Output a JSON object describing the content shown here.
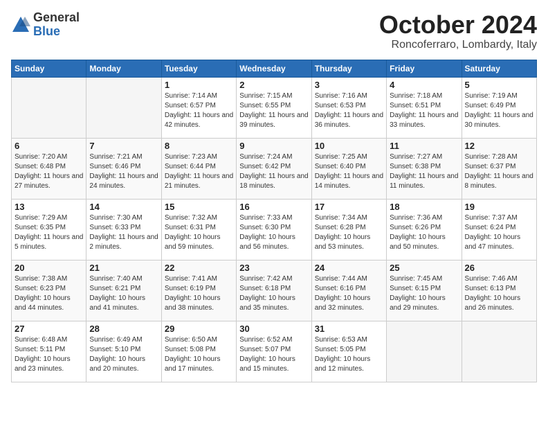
{
  "header": {
    "logo_general": "General",
    "logo_blue": "Blue",
    "month_title": "October 2024",
    "location": "Roncoferraro, Lombardy, Italy"
  },
  "calendar": {
    "days_of_week": [
      "Sunday",
      "Monday",
      "Tuesday",
      "Wednesday",
      "Thursday",
      "Friday",
      "Saturday"
    ],
    "weeks": [
      [
        {
          "day": "",
          "info": ""
        },
        {
          "day": "",
          "info": ""
        },
        {
          "day": "1",
          "info": "Sunrise: 7:14 AM\nSunset: 6:57 PM\nDaylight: 11 hours and 42 minutes."
        },
        {
          "day": "2",
          "info": "Sunrise: 7:15 AM\nSunset: 6:55 PM\nDaylight: 11 hours and 39 minutes."
        },
        {
          "day": "3",
          "info": "Sunrise: 7:16 AM\nSunset: 6:53 PM\nDaylight: 11 hours and 36 minutes."
        },
        {
          "day": "4",
          "info": "Sunrise: 7:18 AM\nSunset: 6:51 PM\nDaylight: 11 hours and 33 minutes."
        },
        {
          "day": "5",
          "info": "Sunrise: 7:19 AM\nSunset: 6:49 PM\nDaylight: 11 hours and 30 minutes."
        }
      ],
      [
        {
          "day": "6",
          "info": "Sunrise: 7:20 AM\nSunset: 6:48 PM\nDaylight: 11 hours and 27 minutes."
        },
        {
          "day": "7",
          "info": "Sunrise: 7:21 AM\nSunset: 6:46 PM\nDaylight: 11 hours and 24 minutes."
        },
        {
          "day": "8",
          "info": "Sunrise: 7:23 AM\nSunset: 6:44 PM\nDaylight: 11 hours and 21 minutes."
        },
        {
          "day": "9",
          "info": "Sunrise: 7:24 AM\nSunset: 6:42 PM\nDaylight: 11 hours and 18 minutes."
        },
        {
          "day": "10",
          "info": "Sunrise: 7:25 AM\nSunset: 6:40 PM\nDaylight: 11 hours and 14 minutes."
        },
        {
          "day": "11",
          "info": "Sunrise: 7:27 AM\nSunset: 6:38 PM\nDaylight: 11 hours and 11 minutes."
        },
        {
          "day": "12",
          "info": "Sunrise: 7:28 AM\nSunset: 6:37 PM\nDaylight: 11 hours and 8 minutes."
        }
      ],
      [
        {
          "day": "13",
          "info": "Sunrise: 7:29 AM\nSunset: 6:35 PM\nDaylight: 11 hours and 5 minutes."
        },
        {
          "day": "14",
          "info": "Sunrise: 7:30 AM\nSunset: 6:33 PM\nDaylight: 11 hours and 2 minutes."
        },
        {
          "day": "15",
          "info": "Sunrise: 7:32 AM\nSunset: 6:31 PM\nDaylight: 10 hours and 59 minutes."
        },
        {
          "day": "16",
          "info": "Sunrise: 7:33 AM\nSunset: 6:30 PM\nDaylight: 10 hours and 56 minutes."
        },
        {
          "day": "17",
          "info": "Sunrise: 7:34 AM\nSunset: 6:28 PM\nDaylight: 10 hours and 53 minutes."
        },
        {
          "day": "18",
          "info": "Sunrise: 7:36 AM\nSunset: 6:26 PM\nDaylight: 10 hours and 50 minutes."
        },
        {
          "day": "19",
          "info": "Sunrise: 7:37 AM\nSunset: 6:24 PM\nDaylight: 10 hours and 47 minutes."
        }
      ],
      [
        {
          "day": "20",
          "info": "Sunrise: 7:38 AM\nSunset: 6:23 PM\nDaylight: 10 hours and 44 minutes."
        },
        {
          "day": "21",
          "info": "Sunrise: 7:40 AM\nSunset: 6:21 PM\nDaylight: 10 hours and 41 minutes."
        },
        {
          "day": "22",
          "info": "Sunrise: 7:41 AM\nSunset: 6:19 PM\nDaylight: 10 hours and 38 minutes."
        },
        {
          "day": "23",
          "info": "Sunrise: 7:42 AM\nSunset: 6:18 PM\nDaylight: 10 hours and 35 minutes."
        },
        {
          "day": "24",
          "info": "Sunrise: 7:44 AM\nSunset: 6:16 PM\nDaylight: 10 hours and 32 minutes."
        },
        {
          "day": "25",
          "info": "Sunrise: 7:45 AM\nSunset: 6:15 PM\nDaylight: 10 hours and 29 minutes."
        },
        {
          "day": "26",
          "info": "Sunrise: 7:46 AM\nSunset: 6:13 PM\nDaylight: 10 hours and 26 minutes."
        }
      ],
      [
        {
          "day": "27",
          "info": "Sunrise: 6:48 AM\nSunset: 5:11 PM\nDaylight: 10 hours and 23 minutes."
        },
        {
          "day": "28",
          "info": "Sunrise: 6:49 AM\nSunset: 5:10 PM\nDaylight: 10 hours and 20 minutes."
        },
        {
          "day": "29",
          "info": "Sunrise: 6:50 AM\nSunset: 5:08 PM\nDaylight: 10 hours and 17 minutes."
        },
        {
          "day": "30",
          "info": "Sunrise: 6:52 AM\nSunset: 5:07 PM\nDaylight: 10 hours and 15 minutes."
        },
        {
          "day": "31",
          "info": "Sunrise: 6:53 AM\nSunset: 5:05 PM\nDaylight: 10 hours and 12 minutes."
        },
        {
          "day": "",
          "info": ""
        },
        {
          "day": "",
          "info": ""
        }
      ]
    ]
  }
}
